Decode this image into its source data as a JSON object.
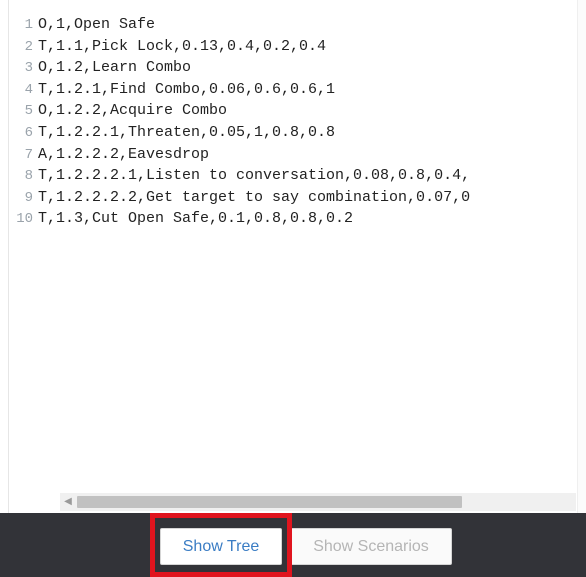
{
  "editor": {
    "lines": [
      {
        "num": "1",
        "text": "O,1,Open Safe"
      },
      {
        "num": "2",
        "text": "T,1.1,Pick Lock,0.13,0.4,0.2,0.4"
      },
      {
        "num": "3",
        "text": "O,1.2,Learn Combo"
      },
      {
        "num": "4",
        "text": "T,1.2.1,Find Combo,0.06,0.6,0.6,1"
      },
      {
        "num": "5",
        "text": "O,1.2.2,Acquire Combo"
      },
      {
        "num": "6",
        "text": "T,1.2.2.1,Threaten,0.05,1,0.8,0.8"
      },
      {
        "num": "7",
        "text": "A,1.2.2.2,Eavesdrop"
      },
      {
        "num": "8",
        "text": "T,1.2.2.2.1,Listen to conversation,0.08,0.8,0.4,"
      },
      {
        "num": "9",
        "text": "T,1.2.2.2.2,Get target to say combination,0.07,0"
      },
      {
        "num": "10",
        "text": "T,1.3,Cut Open Safe,0.1,0.8,0.8,0.2"
      }
    ]
  },
  "footer": {
    "show_tree_label": "Show Tree",
    "show_scenarios_label": "Show Scenarios"
  },
  "colors": {
    "footer_background": "#323338",
    "highlight": "#e0141e",
    "primary_text": "#3b7dc4"
  },
  "icons": {
    "scroll_left": "scroll-left-arrow-icon"
  }
}
